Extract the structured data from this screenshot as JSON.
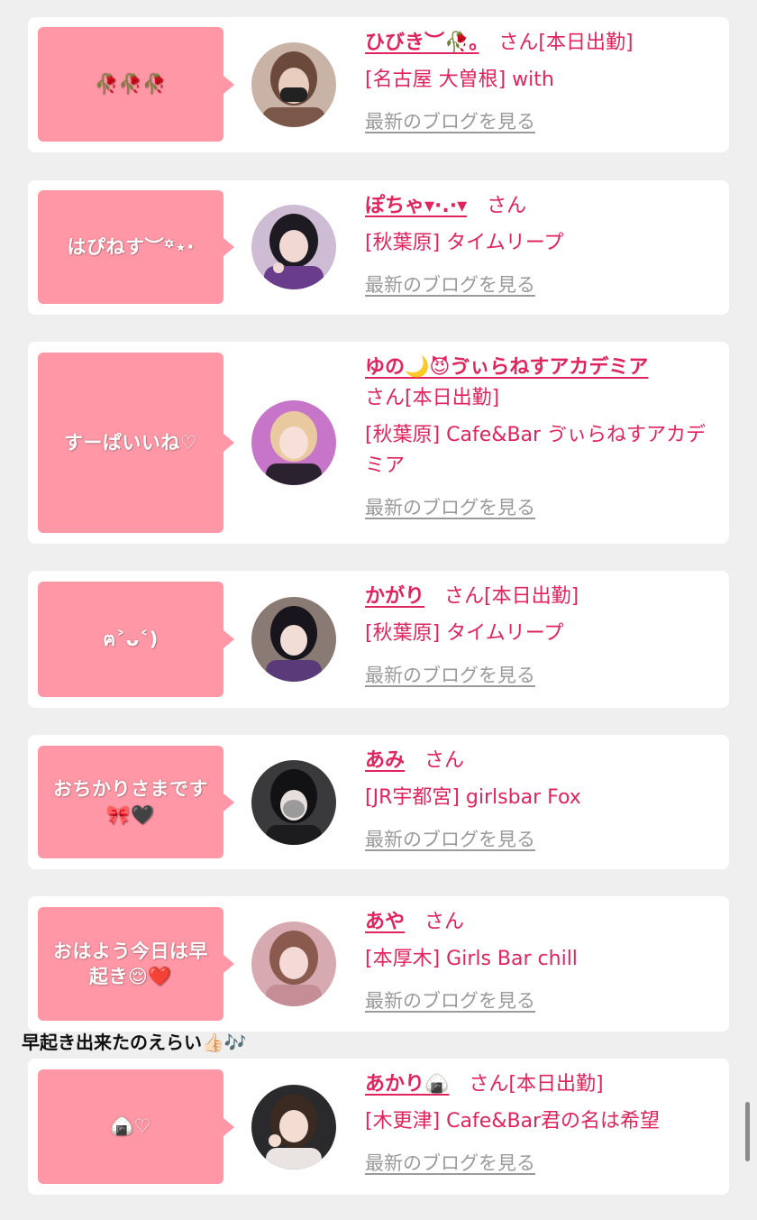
{
  "posts": [
    {
      "bubble": "🥀🥀🥀",
      "name": "ひびき︶🥀｡",
      "suffix": "さん[本日出勤]",
      "shop": "[名古屋 大曽根] with",
      "blog_link": "最新のブログを見る"
    },
    {
      "bubble": "はぴねす︶꙳⋆‧",
      "name": "ぽちゃ▾·.·▾",
      "suffix": "さん",
      "shop": "[秋葉原] タイムリープ",
      "blog_link": "最新のブログを見る"
    },
    {
      "bubble": "すーぱいいね♡",
      "name": "ゆの🌙😈ゔぃらねすアカデミア",
      "suffix": "さん[本日出勤]",
      "shop": "[秋葉原] Cafe&Bar ゔぃらねすアカデミア",
      "blog_link": "最新のブログを見る"
    },
    {
      "bubble": "ฅ˃ᴗ˂)",
      "name": "かがり",
      "suffix": "さん[本日出勤]",
      "shop": "[秋葉原] タイムリープ",
      "blog_link": "最新のブログを見る"
    },
    {
      "bubble": "おちかりさまです🎀🖤",
      "name": "あみ",
      "suffix": "さん",
      "shop": "[JR宇都宮] girlsbar Fox",
      "blog_link": "最新のブログを見る"
    },
    {
      "bubble": "おはよう今日は早起き😌❤️",
      "name": "あや",
      "suffix": "さん",
      "shop": "[本厚木] Girls Bar chill",
      "blog_link": "最新のブログを見る"
    },
    {
      "bubble": "🍙♡",
      "name": "あかり🍙",
      "suffix": "さん[本日出勤]",
      "shop": "[木更津] Cafe&Bar君の名は希望",
      "blog_link": "最新のブログを見る"
    }
  ],
  "overlay_caption": "早起き出来たのえらい👍🏻🎶",
  "colors": {
    "page_bg": "#efefef",
    "card_bg": "#ffffff",
    "bubble_bg": "#ff97a6",
    "accent": "#e0245e",
    "link_gray": "#9a9a9a"
  },
  "icons": {
    "avatar": "profile-photo",
    "scrollbar": "scroll-thumb"
  }
}
